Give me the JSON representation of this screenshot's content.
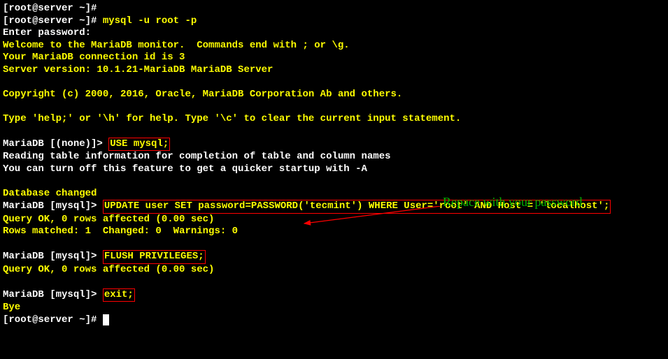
{
  "prompt1": "[root@server ~]#",
  "prompt2": "[root@server ~]# ",
  "cmd_mysql": "mysql -u root -p",
  "enter_pw": "Enter password:",
  "welcome1": "Welcome to the MariaDB monitor.  Commands end with ; or \\g.",
  "welcome2": "Your MariaDB connection id is 3",
  "welcome3": "Server version: 10.1.21-MariaDB MariaDB Server",
  "copyright": "Copyright (c) 2000, 2016, Oracle, MariaDB Corporation Ab and others.",
  "helpline": "Type 'help;' or '\\h' for help. Type '\\c' to clear the current input statement.",
  "mdb_none": "MariaDB [(none)]> ",
  "cmd_use": "USE mysql;",
  "reading1": "Reading table information for completion of table and column names",
  "reading2": "You can turn off this feature to get a quicker startup with -A",
  "db_changed": "Database changed",
  "mdb_mysql": "MariaDB [mysql]> ",
  "cmd_update": "UPDATE user SET password=PASSWORD('tecmint') WHERE User='root' AND Host = 'localhost';",
  "update_ok": "Query OK, 0 rows affected (0.00 sec)",
  "update_matched": "Rows matched: 1  Changed: 0  Warnings: 0",
  "cmd_flush": "FLUSH PRIVILEGES;",
  "flush_ok": "Query OK, 0 rows affected (0.00 sec)",
  "cmd_exit": "exit;",
  "bye": "Bye",
  "final_prompt": "[root@server ~]# ",
  "annotation": "Repace with your password"
}
